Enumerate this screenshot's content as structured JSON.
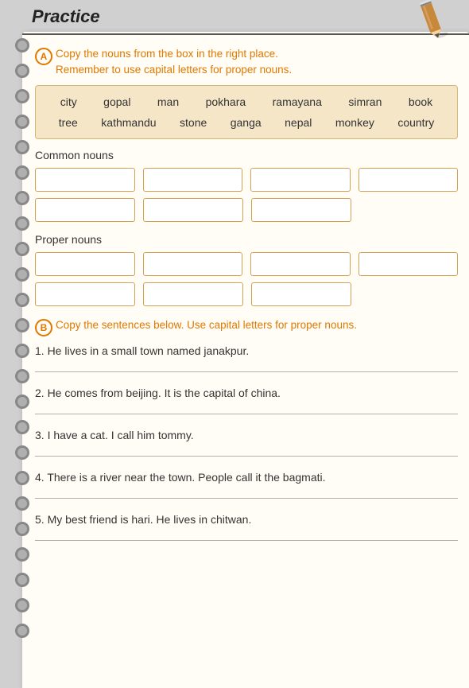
{
  "page": {
    "title": "Practice",
    "background_color": "#d0d0d0"
  },
  "sectionA": {
    "circle_label": "A",
    "instruction_line1": "Copy the nouns from the box in the right place.",
    "instruction_line2": "Remember to use capital letters for proper nouns.",
    "word_row1": [
      "city",
      "gopal",
      "man",
      "pokhara",
      "ramayana",
      "simran",
      "book"
    ],
    "word_row2": [
      "tree",
      "kathmandu",
      "stone",
      "ganga",
      "nepal",
      "monkey",
      "country"
    ],
    "common_nouns_label": "Common nouns",
    "proper_nouns_label": "Proper nouns"
  },
  "sectionB": {
    "circle_label": "B",
    "instruction": "Copy the sentences below. Use capital letters for proper nouns.",
    "sentences": [
      "1. He lives in a small town named janakpur.",
      "2. He comes from beijing. It is the capital of china.",
      "3. I have a cat. I call him tommy.",
      "4. There is a river near the town. People call it the bagmati.",
      "5. My best friend is hari. He lives in chitwan."
    ]
  },
  "rings_count": 24
}
